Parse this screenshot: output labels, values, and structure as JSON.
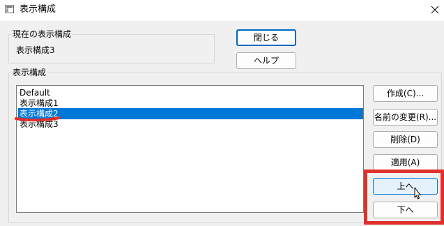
{
  "window": {
    "title": "表示構成"
  },
  "current": {
    "group_label": "現在の表示構成",
    "value": "表示構成3"
  },
  "buttons": {
    "close_label": "閉じる",
    "help_label": "ヘルプ",
    "create_label": "作成(C)...",
    "rename_label": "名前の変更(R)...",
    "delete_label": "削除(D)",
    "apply_label": "適用(A)",
    "up_label": "上へ",
    "down_label": "下へ"
  },
  "list": {
    "group_label": "表示構成",
    "items": [
      {
        "label": "Default",
        "selected": false
      },
      {
        "label": "表示構成1",
        "selected": false
      },
      {
        "label": "表示構成2",
        "selected": true
      },
      {
        "label": "表示構成3",
        "selected": false
      }
    ]
  },
  "colors": {
    "selection": "#0078d7",
    "annotation": "#e0302c",
    "default_button_border": "#0067c0"
  }
}
